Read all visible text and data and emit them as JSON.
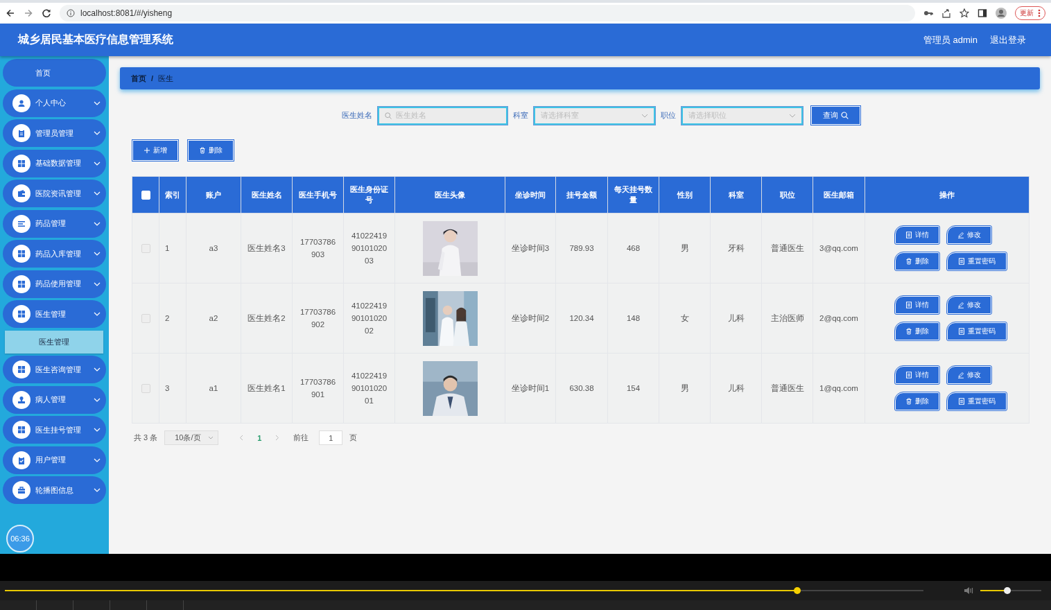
{
  "browser": {
    "url": "localhost:8081/#/yisheng",
    "update_button": "更新"
  },
  "header": {
    "title": "城乡居民基本医疗信息管理系统",
    "user": "管理员 admin",
    "logout": "退出登录"
  },
  "sidebar": {
    "items": [
      {
        "label": "首页",
        "kind": "link"
      },
      {
        "label": "个人中心",
        "kind": "group"
      },
      {
        "label": "管理员管理",
        "kind": "group"
      },
      {
        "label": "基础数据管理",
        "kind": "group"
      },
      {
        "label": "医院资讯管理",
        "kind": "group"
      },
      {
        "label": "药品管理",
        "kind": "group"
      },
      {
        "label": "药品入库管理",
        "kind": "group"
      },
      {
        "label": "药品使用管理",
        "kind": "group"
      },
      {
        "label": "医生管理",
        "kind": "group",
        "children": [
          {
            "label": "医生管理",
            "selected": true
          }
        ]
      },
      {
        "label": "医生咨询管理",
        "kind": "group"
      },
      {
        "label": "病人管理",
        "kind": "group"
      },
      {
        "label": "医生挂号管理",
        "kind": "group"
      },
      {
        "label": "用户管理",
        "kind": "group"
      },
      {
        "label": "轮播图信息",
        "kind": "group"
      }
    ],
    "timer": "06:36"
  },
  "breadcrumb": {
    "items": [
      "首页",
      "医生"
    ],
    "separator": "/"
  },
  "search": {
    "fields": [
      {
        "label": "医生姓名",
        "kind": "text",
        "placeholder": "医生姓名"
      },
      {
        "label": "科室",
        "kind": "select",
        "placeholder": "请选择科室"
      },
      {
        "label": "职位",
        "kind": "select",
        "placeholder": "请选择职位"
      }
    ],
    "button": "查询"
  },
  "toolbar": [
    {
      "label": "新增",
      "kind": "add"
    },
    {
      "label": "删除",
      "kind": "delete"
    }
  ],
  "table": {
    "header_checked": false,
    "columns": [
      "索引",
      "账户",
      "医生姓名",
      "医生手机号",
      "医生身份证号",
      "医生头像",
      "坐诊时间",
      "挂号金额",
      "每天挂号数量",
      "性别",
      "科室",
      "职位",
      "医生邮箱",
      "操作"
    ],
    "rows": [
      {
        "checked": false,
        "cells": [
          "1",
          "a3",
          "医生姓名3",
          "17703786903",
          "410224199010102003"
        ],
        "avatar": {
          "kind": "picture"
        },
        "cells_after": [
          "坐诊时间3",
          "789.93",
          "468",
          "男",
          "牙科",
          "普通医生",
          "3@qq.com"
        ],
        "actions": [
          {
            "label": "详情",
            "kind": "detail"
          },
          {
            "label": "修改",
            "kind": "edit"
          },
          {
            "label": "删除",
            "kind": "delete"
          },
          {
            "label": "重置密码",
            "kind": "reset"
          }
        ]
      },
      {
        "checked": false,
        "cells": [
          "2",
          "a2",
          "医生姓名2",
          "17703786902",
          "410224199010102002"
        ],
        "avatar": {
          "kind": "picture"
        },
        "cells_after": [
          "坐诊时间2",
          "120.34",
          "148",
          "女",
          "儿科",
          "主治医师",
          "2@qq.com"
        ],
        "actions": [
          {
            "label": "详情",
            "kind": "detail"
          },
          {
            "label": "修改",
            "kind": "edit"
          },
          {
            "label": "删除",
            "kind": "delete"
          },
          {
            "label": "重置密码",
            "kind": "reset"
          }
        ]
      },
      {
        "checked": false,
        "cells": [
          "3",
          "a1",
          "医生姓名1",
          "17703786901",
          "410224199010102001"
        ],
        "avatar": {
          "kind": "picture"
        },
        "cells_after": [
          "坐诊时间1",
          "630.38",
          "154",
          "男",
          "儿科",
          "普通医生",
          "1@qq.com"
        ],
        "actions": [
          {
            "label": "详情",
            "kind": "detail"
          },
          {
            "label": "修改",
            "kind": "edit"
          },
          {
            "label": "删除",
            "kind": "delete"
          },
          {
            "label": "重置密码",
            "kind": "reset"
          }
        ]
      }
    ]
  },
  "pagination": {
    "total": "共 3 条",
    "page_size": "10条/页",
    "pages": [
      {
        "label": "1",
        "selected": true
      }
    ],
    "goto_label": "前往",
    "goto_value": "1",
    "goto_suffix": "页"
  },
  "player": {
    "progress": {
      "level": 0.863
    },
    "volume": {
      "level": 0.44
    }
  }
}
